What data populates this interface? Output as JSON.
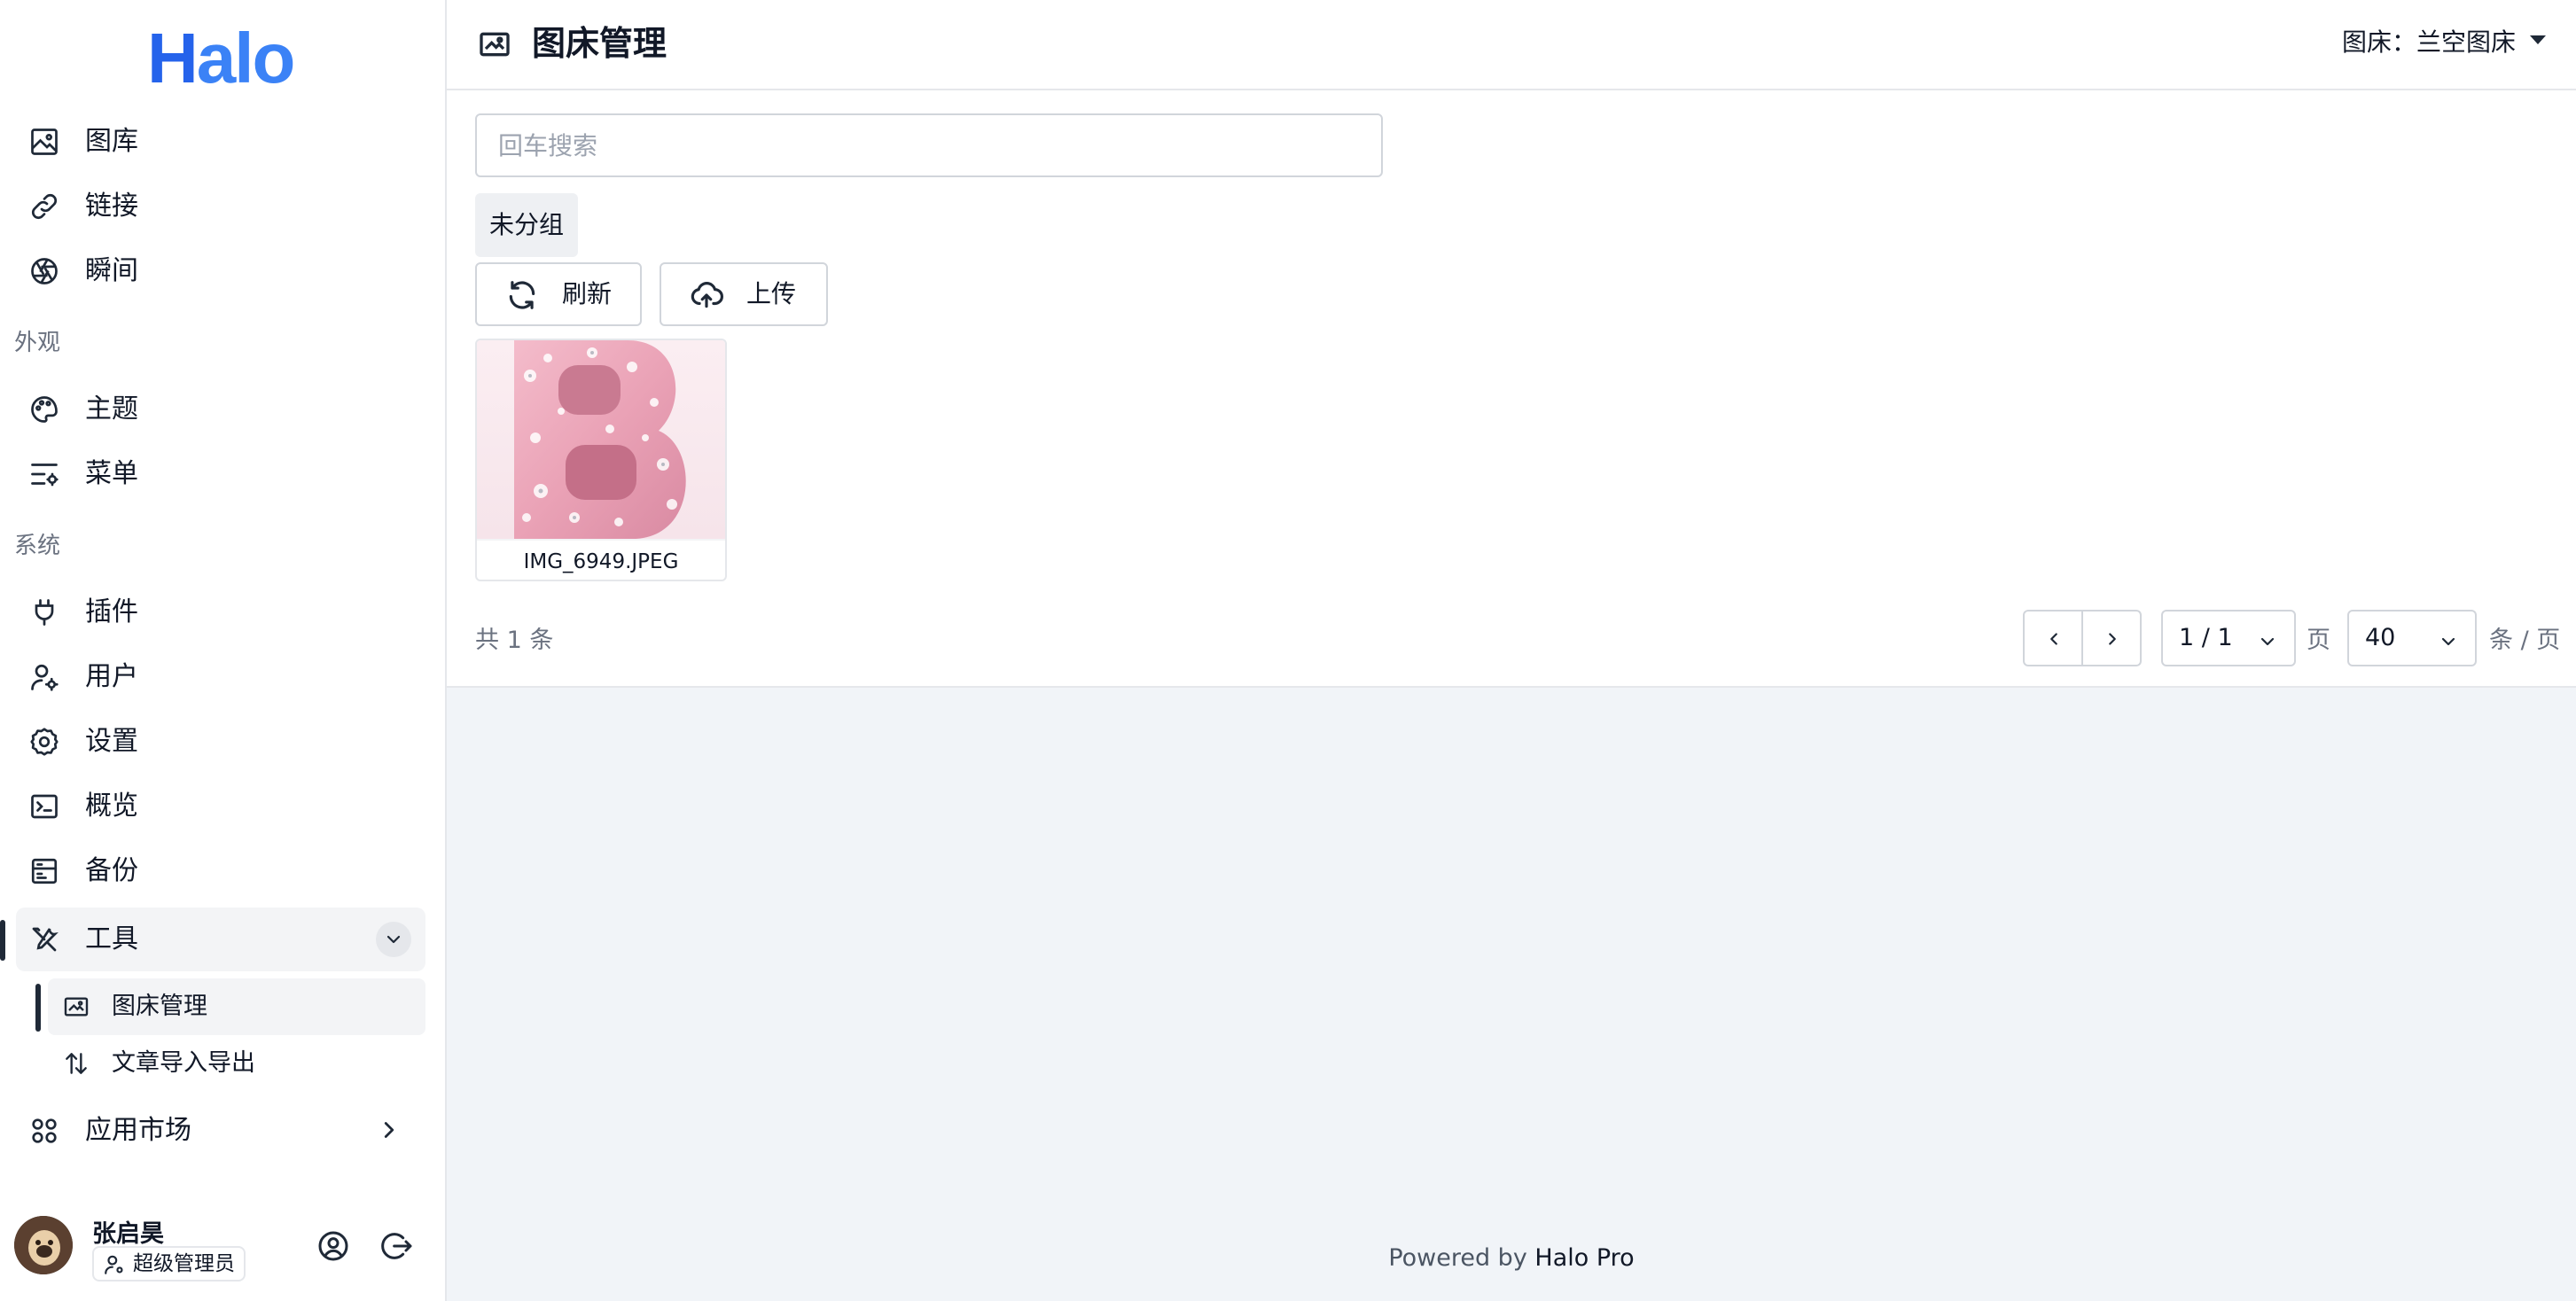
{
  "app": {
    "logo_text_h": "H",
    "logo_text_rest": "alo",
    "brand_color": "#2563eb"
  },
  "sidebar": {
    "items": [
      {
        "label": "图库",
        "icon": "image-icon"
      },
      {
        "label": "链接",
        "icon": "link-icon"
      },
      {
        "label": "瞬间",
        "icon": "aperture-icon"
      }
    ],
    "group_appearance": "外观",
    "appearance_items": [
      {
        "label": "主题",
        "icon": "palette-icon"
      },
      {
        "label": "菜单",
        "icon": "menu-settings-icon"
      }
    ],
    "group_system": "系统",
    "system_items": [
      {
        "label": "插件",
        "icon": "plug-icon"
      },
      {
        "label": "用户",
        "icon": "user-settings-icon"
      },
      {
        "label": "设置",
        "icon": "gear-icon"
      },
      {
        "label": "概览",
        "icon": "terminal-icon"
      },
      {
        "label": "备份",
        "icon": "backup-icon"
      }
    ],
    "tools": {
      "label": "工具",
      "icon": "tools-icon",
      "expanded": true
    },
    "tools_sub": [
      {
        "label": "图床管理",
        "icon": "image-hosting-icon",
        "active": true
      },
      {
        "label": "文章导入导出",
        "icon": "sort-arrows-icon",
        "active": false
      }
    ],
    "app_market": {
      "label": "应用市场",
      "icon": "grid-icon"
    }
  },
  "user": {
    "name": "张启昊",
    "role": "超级管理员"
  },
  "header": {
    "title": "图床管理",
    "hosting_label": "图床：兰空图床"
  },
  "main": {
    "search_placeholder": "回车搜索",
    "group_chip": "未分组",
    "refresh_label": "刷新",
    "upload_label": "上传",
    "images": [
      {
        "name": "IMG_6949.JPEG"
      }
    ],
    "total": "共 1 条",
    "page_value": "1 / 1",
    "page_unit": "页",
    "page_size": "40",
    "page_size_unit": "条 / 页"
  },
  "footer": {
    "prefix": "Powered by ",
    "brand": "Halo Pro"
  }
}
